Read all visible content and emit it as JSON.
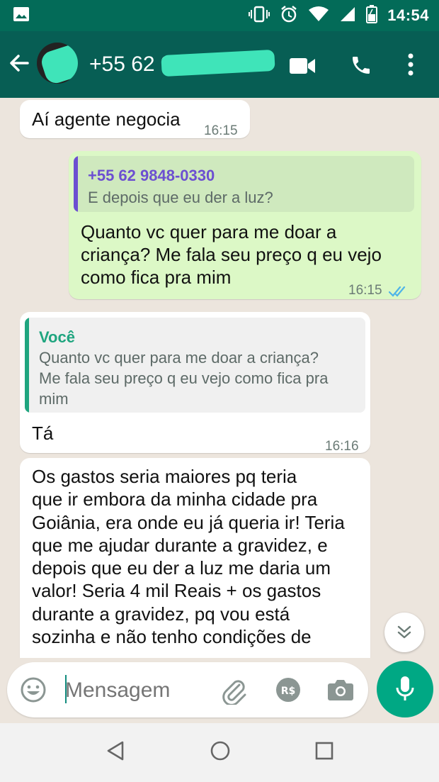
{
  "status_bar": {
    "time": "14:54"
  },
  "header": {
    "contact": "+55 62 9"
  },
  "messages": [
    {
      "text": "Aí agente negocia",
      "time": "16:15"
    },
    {
      "quote_name": "+55 62 9848-0330",
      "quote_text": "E depois que eu der a luz?",
      "lines": [
        "Quanto vc quer para me doar a",
        "criança? Me fala seu preço q eu vejo",
        "como fica pra mim"
      ],
      "time": "16:15"
    },
    {
      "quote_name": "Você",
      "quote_lines": [
        "Quanto vc quer para me doar a criança?",
        "Me fala seu preço q eu vejo como fica pra",
        "mim"
      ],
      "text": "Tá",
      "time": "16:16"
    },
    {
      "lines": [
        "Os gastos seria maiores pq teria",
        "que ir embora da minha cidade pra",
        "Goiânia, era onde eu já queria ir! Teria",
        "que me ajudar durante a gravidez, e",
        "depois que eu der a luz me daria um",
        "valor! Seria 4 mil Reais + os gastos",
        "durante a gravidez, pq vou está",
        "sozinha e não tenho condições de"
      ]
    }
  ],
  "composer": {
    "placeholder": "Mensagem"
  },
  "colors": {
    "header": "#075e54",
    "outgoing": "#dcf8c6",
    "incoming": "#ffffff",
    "fab": "#00a884"
  }
}
